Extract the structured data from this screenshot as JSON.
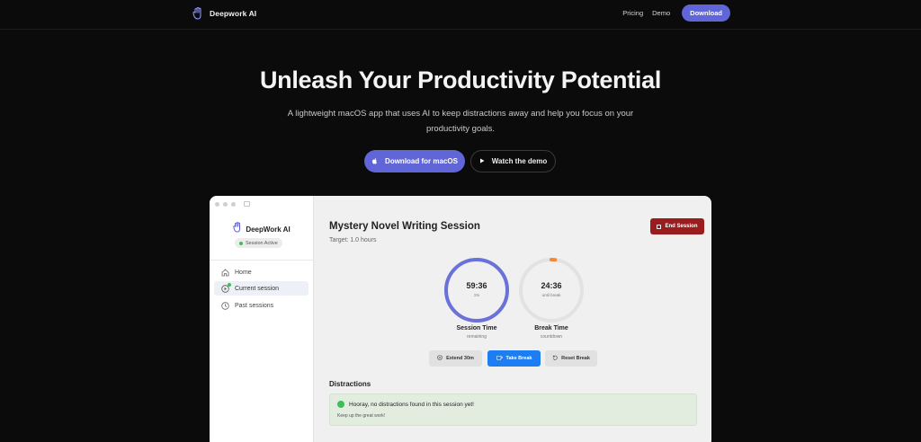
{
  "nav": {
    "brand": "Deepwork AI",
    "links": [
      "Pricing",
      "Demo"
    ],
    "download": "Download"
  },
  "hero": {
    "title": "Unleash Your Productivity Potential",
    "subtitle": "A lightweight macOS app that uses AI to keep distractions away and help you focus on your productivity goals.",
    "primary_cta": "Download for macOS",
    "secondary_cta": "Watch the demo"
  },
  "app": {
    "sidebar": {
      "brand": "DeepWork AI",
      "status": "Session Active",
      "items": [
        {
          "label": "Home",
          "icon": "home-icon"
        },
        {
          "label": "Current session",
          "icon": "play-circle-icon",
          "active": true
        },
        {
          "label": "Past sessions",
          "icon": "clock-icon"
        }
      ]
    },
    "session": {
      "title": "Mystery Novel Writing Session",
      "target": "Target: 1.0 hours",
      "end_button": "End Session"
    },
    "timers": {
      "session": {
        "value": "59:36",
        "sub": "1%",
        "label": "Session Time",
        "caption": "remaining",
        "progress": 0.99,
        "color": "#6a71d9"
      },
      "break": {
        "value": "24:36",
        "sub": "until break",
        "label": "Break Time",
        "caption": "countdown",
        "progress": 0.02,
        "color": "#f0883e"
      }
    },
    "controls": {
      "extend": "Extend 30m",
      "take_break": "Take Break",
      "reset_break": "Reset Break"
    },
    "distractions": {
      "title": "Distractions",
      "message": "Hooray, no distractions found in this session yet!",
      "sub": "Keep up the great work!"
    }
  },
  "colors": {
    "accent": "#6065d8",
    "danger": "#9b1c1c",
    "primary_blue": "#1c7ef2",
    "success": "#3cbf5a"
  }
}
